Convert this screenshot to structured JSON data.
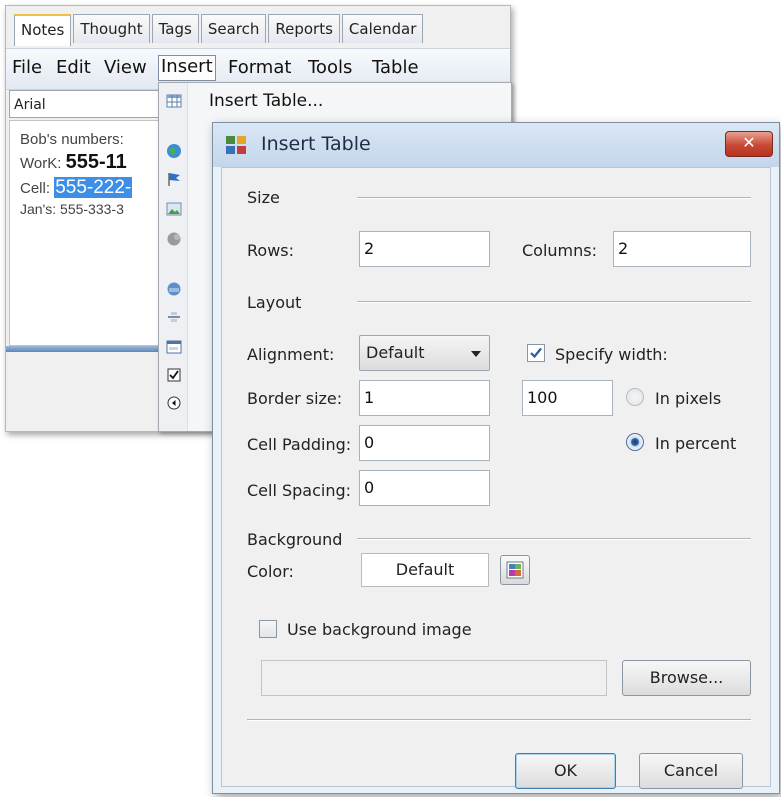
{
  "app": {
    "tabs": [
      "Notes",
      "Thought",
      "Tags",
      "Search",
      "Reports",
      "Calendar"
    ],
    "menus": [
      "File",
      "Edit",
      "View",
      "Insert",
      "Format",
      "Tools",
      "Table"
    ],
    "font": "Arial",
    "notes": [
      {
        "label": "Bob's numbers:",
        "value": ""
      },
      {
        "label": "WorK:",
        "value": "555-11"
      },
      {
        "label": "Cell:",
        "value": "555-222-"
      },
      {
        "label": "Jan's:",
        "value": "555-333-3"
      }
    ]
  },
  "insert_menu": {
    "items": [
      {
        "label": "Insert Table...",
        "icon": "table-icon"
      }
    ],
    "icons": [
      "globe-icon",
      "flag-icon",
      "picture-icon",
      "shape-icon",
      "link-icon",
      "horizontal-rule-icon",
      "form-icon",
      "checkbox-icon",
      "radio-icon"
    ]
  },
  "dialog": {
    "title": "Insert Table",
    "close_label": "✕",
    "size_section": "Size",
    "rows_label": "Rows:",
    "rows_value": "2",
    "columns_label": "Columns:",
    "columns_value": "2",
    "layout_section": "Layout",
    "alignment_label": "Alignment:",
    "alignment_value": "Default",
    "specify_width_label": "Specify width:",
    "specify_width_checked": true,
    "border_label": "Border size:",
    "border_value": "1",
    "width_value": "100",
    "in_pixels_label": "In pixels",
    "in_percent_label": "In percent",
    "width_unit": "percent",
    "padding_label": "Cell Padding:",
    "padding_value": "0",
    "spacing_label": "Cell Spacing:",
    "spacing_value": "0",
    "background_section": "Background",
    "color_label": "Color:",
    "color_value": "Default",
    "use_bg_image_label": "Use background image",
    "use_bg_image_checked": false,
    "bg_image_path": "",
    "browse_label": "Browse...",
    "ok_label": "OK",
    "cancel_label": "Cancel"
  },
  "colors": {
    "title_bar": "#c4d6eb",
    "close_button": "#c74a36",
    "selection": "#3d8ee6",
    "tab_accent": "#f2c04a"
  }
}
